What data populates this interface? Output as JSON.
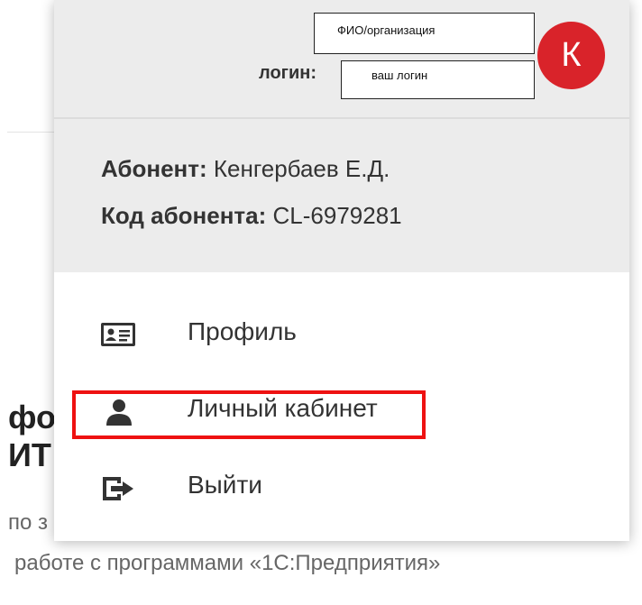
{
  "background": {
    "heading_line1": "фо",
    "heading_line2": "ИТ",
    "text_line1": "по з",
    "text_line2": "работе с программами «1С:Предприятия»"
  },
  "header": {
    "name_placeholder": "ФИО/организация",
    "login_label": "логин:",
    "login_placeholder": "ваш логин",
    "avatar_letter": "К",
    "avatar_color": "#d9232a"
  },
  "info": {
    "subscriber_label": "Абонент:",
    "subscriber_value": "Кенгербаев Е.Д.",
    "code_label": "Код абонента:",
    "code_value": "CL-6979281"
  },
  "menu": {
    "items": [
      {
        "label": "Профиль",
        "icon": "id-card-icon"
      },
      {
        "label": "Личный кабинет",
        "icon": "user-icon"
      },
      {
        "label": "Выйти",
        "icon": "logout-icon"
      }
    ]
  },
  "annotation": {
    "highlight_color": "#ee1111",
    "highlighted_item": "Личный кабинет"
  }
}
